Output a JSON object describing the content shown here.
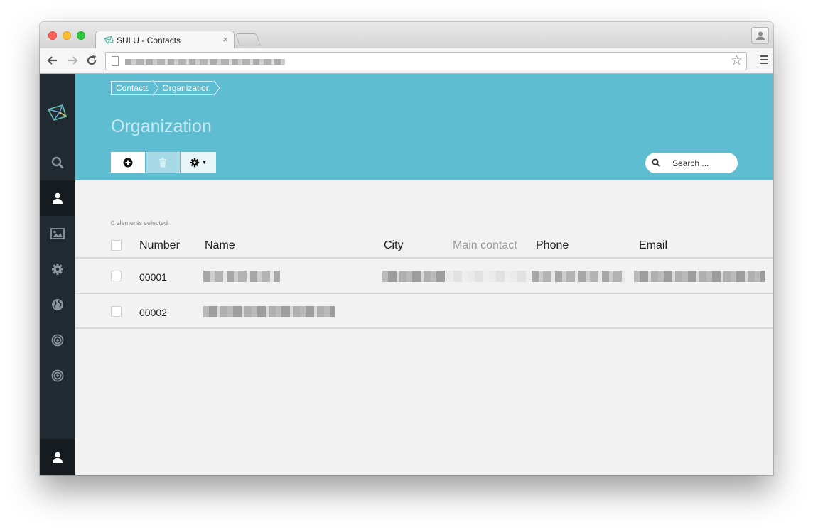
{
  "browser": {
    "tab_title": "SULU - Contacts",
    "tab_close": "×",
    "bookmark_glyph": "☆"
  },
  "breadcrumb": [
    "Contacts",
    "Organization"
  ],
  "page": {
    "title": "Organization"
  },
  "toolbar": {
    "add_icon": "plus-circle-icon",
    "delete_icon": "trash-icon",
    "settings_icon": "gear-icon",
    "settings_caret": "▼"
  },
  "search": {
    "placeholder": "Search ..."
  },
  "sidebar": {
    "items": [
      {
        "icon": "search-icon",
        "active": false
      },
      {
        "icon": "user-icon",
        "active": true
      },
      {
        "icon": "image-icon",
        "active": false
      },
      {
        "icon": "gear-icon",
        "active": false
      },
      {
        "icon": "globe-icon",
        "active": false
      },
      {
        "icon": "target-icon",
        "active": false
      },
      {
        "icon": "target-icon",
        "active": false
      }
    ],
    "bottom_icon": "user-icon"
  },
  "list": {
    "selected_text": "0 elements selected",
    "columns": [
      "Number",
      "Name",
      "City",
      "Main contact",
      "Phone",
      "Email"
    ],
    "rows": [
      {
        "number": "00001"
      },
      {
        "number": "00002"
      }
    ]
  },
  "colors": {
    "header": "#5fbdd1",
    "sidebar": "#222a31",
    "sidebar_active": "#161b20",
    "background": "#f2f2f2"
  }
}
